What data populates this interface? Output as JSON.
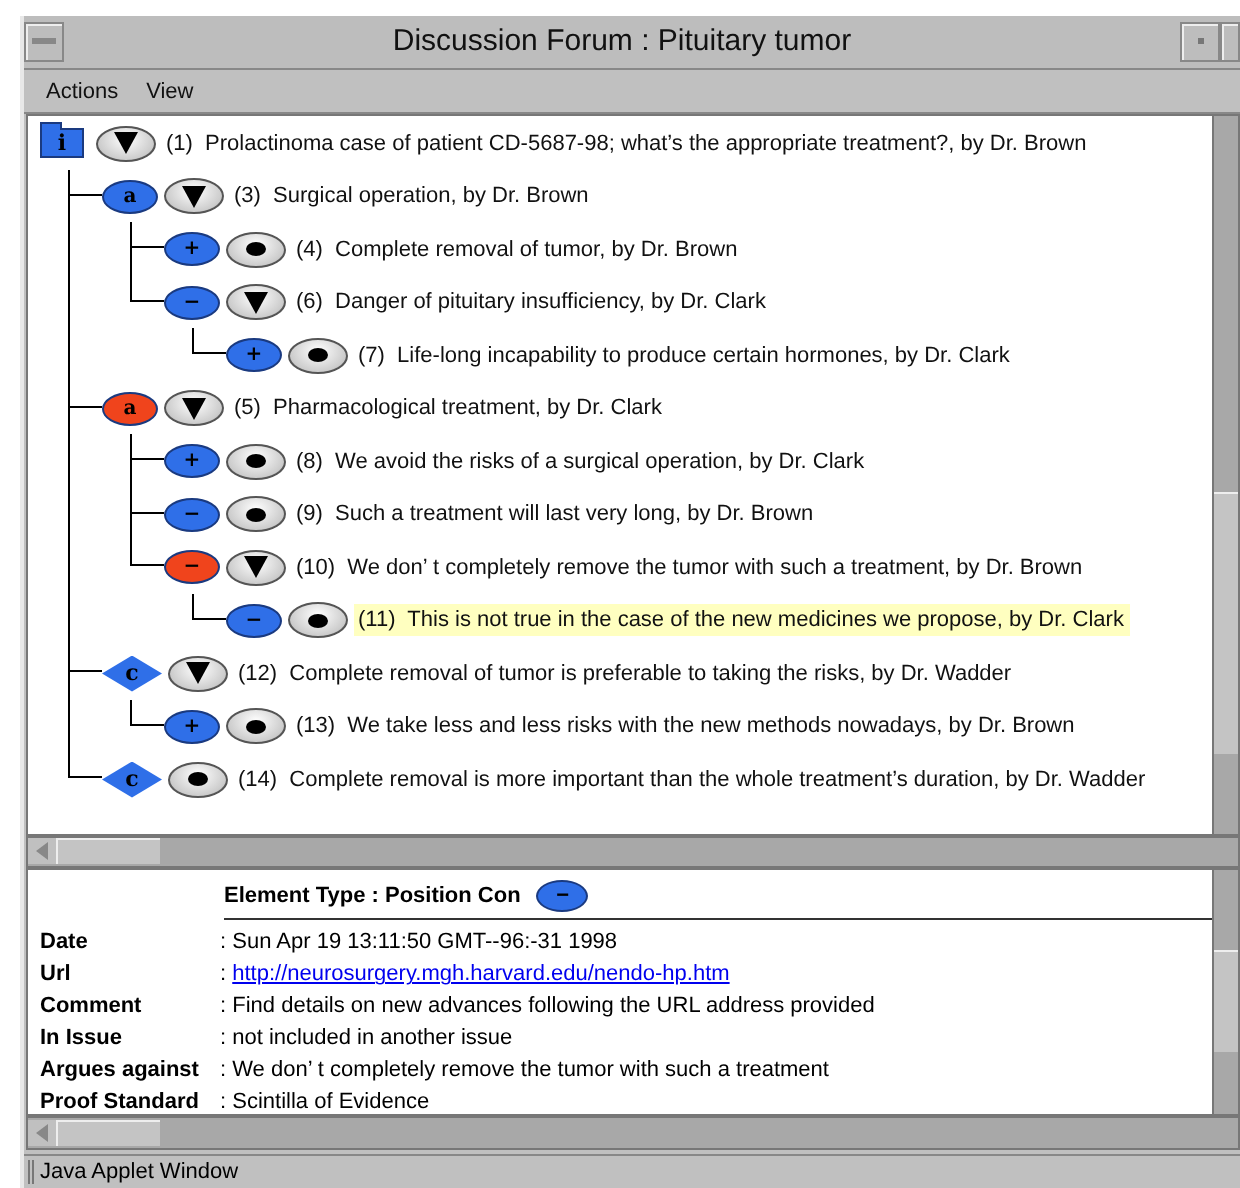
{
  "window": {
    "title": "Discussion Forum : Pituitary tumor"
  },
  "menu": [
    {
      "label": "Actions"
    },
    {
      "label": "View"
    }
  ],
  "tree": [
    {
      "kind": "folder",
      "symbol": "i",
      "color": "#2f6fe8",
      "expanded": true,
      "selected": false,
      "label": "(1)  Prolactinoma case of patient CD-5687-98; what’s the appropriate treatment?, by Dr. Brown",
      "children": [
        {
          "kind": "ellipse",
          "symbol": "a",
          "color": "#2f6fe8",
          "expanded": true,
          "selected": false,
          "label": "(3)  Surgical operation, by Dr. Brown",
          "children": [
            {
              "kind": "ellipse",
              "symbol": "+",
              "color": "#2f6fe8",
              "expanded": false,
              "selected": false,
              "label": "(4)  Complete removal of tumor, by Dr. Brown"
            },
            {
              "kind": "ellipse",
              "symbol": "−",
              "color": "#2f6fe8",
              "expanded": true,
              "selected": false,
              "label": "(6)  Danger of pituitary insufficiency, by Dr. Clark",
              "children": [
                {
                  "kind": "ellipse",
                  "symbol": "+",
                  "color": "#2f6fe8",
                  "expanded": false,
                  "selected": false,
                  "label": "(7)  Life-long incapability to produce certain hormones, by Dr. Clark"
                }
              ]
            }
          ]
        },
        {
          "kind": "ellipse",
          "symbol": "a",
          "color": "#f0441c",
          "expanded": true,
          "selected": false,
          "label": "(5)  Pharmacological treatment, by Dr. Clark",
          "children": [
            {
              "kind": "ellipse",
              "symbol": "+",
              "color": "#2f6fe8",
              "expanded": false,
              "selected": false,
              "label": "(8)  We avoid the risks of a surgical operation, by Dr. Clark"
            },
            {
              "kind": "ellipse",
              "symbol": "−",
              "color": "#2f6fe8",
              "expanded": false,
              "selected": false,
              "label": "(9)  Such a treatment will last very long, by Dr. Brown"
            },
            {
              "kind": "ellipse",
              "symbol": "−",
              "color": "#f0441c",
              "expanded": true,
              "selected": false,
              "label": "(10)  We don’ t completely remove the tumor with such a treatment, by Dr. Brown",
              "children": [
                {
                  "kind": "ellipse",
                  "symbol": "−",
                  "color": "#2f6fe8",
                  "expanded": false,
                  "selected": true,
                  "label": "(11)  This is not true in the case of the new medicines we propose, by Dr. Clark"
                }
              ]
            }
          ]
        },
        {
          "kind": "diamond",
          "symbol": "c",
          "color": "#2f6fe8",
          "expanded": true,
          "selected": false,
          "label": "(12)  Complete removal of tumor is preferable to taking the risks, by Dr. Wadder",
          "children": [
            {
              "kind": "ellipse",
              "symbol": "+",
              "color": "#2f6fe8",
              "expanded": false,
              "selected": false,
              "label": "(13)  We take less and less risks with the new methods nowadays, by Dr. Brown"
            }
          ]
        },
        {
          "kind": "diamond",
          "symbol": "c",
          "color": "#2f6fe8",
          "expanded": false,
          "selected": false,
          "label": "(14)  Complete removal is more important than the whole treatment’s duration, by Dr. Wadder"
        }
      ]
    }
  ],
  "details": {
    "element_type": {
      "label": "Element Type : Position Con",
      "symbol": "−",
      "color": "#2f6fe8"
    },
    "fields": [
      {
        "kind": "text",
        "label": "Date",
        "separator": ":",
        "value": "Sun Apr 19 13:11:50 GMT--96:-31 1998"
      },
      {
        "kind": "link",
        "label": "Url",
        "separator": ":",
        "value": "http://neurosurgery.mgh.harvard.edu/nendo-hp.htm"
      },
      {
        "kind": "text",
        "label": "Comment",
        "separator": ":",
        "value": "Find details on new advances following the URL address provided"
      },
      {
        "kind": "text",
        "label": "In Issue",
        "separator": ":",
        "value": "not included in another issue"
      },
      {
        "kind": "text",
        "label": "Argues against",
        "separator": ":",
        "value": "We don’ t completely remove the tumor with such a treatment"
      },
      {
        "kind": "text",
        "label": "Proof Standard",
        "separator": ":",
        "value": "Scintilla of Evidence"
      }
    ]
  },
  "status_bar": {
    "text": "Java Applet Window"
  }
}
